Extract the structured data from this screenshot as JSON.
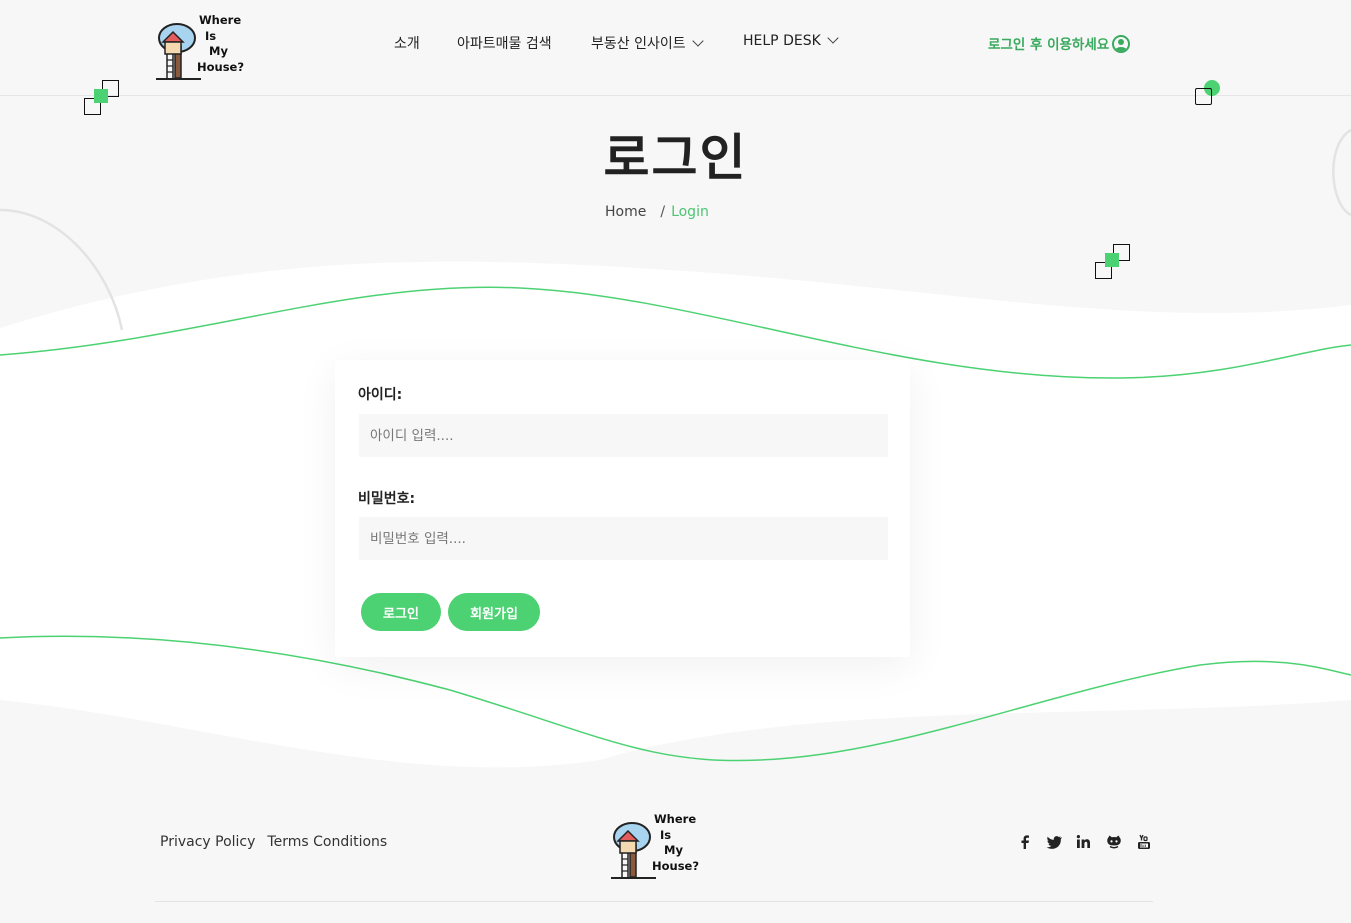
{
  "logo": {
    "lines": [
      "Where",
      "Is",
      "My",
      "House?"
    ]
  },
  "nav": {
    "about": "소개",
    "search": "아파트매물 검색",
    "insight": "부동산 인사이트",
    "helpdesk": "HELP DESK"
  },
  "header": {
    "login_cta": "로그인 후 이용하세요"
  },
  "page": {
    "title": "로그인"
  },
  "breadcrumb": {
    "home": "Home",
    "separator": "/",
    "current": "Login"
  },
  "form": {
    "id_label": "아이디:",
    "id_placeholder": "아이디 입력....",
    "id_value": "",
    "pw_label": "비밀번호:",
    "pw_placeholder": "비밀번호 입력....",
    "pw_value": "",
    "login_button": "로그인",
    "signup_button": "회원가입"
  },
  "footer": {
    "privacy": "Privacy Policy",
    "terms": "Terms Conditions",
    "social_icons": [
      "facebook-icon",
      "twitter-icon",
      "linkedin-icon",
      "github-icon",
      "youtube-icon"
    ]
  },
  "colors": {
    "accent": "#4cd272",
    "accent_text": "#3aaa5e",
    "background": "#f7f7f7"
  }
}
